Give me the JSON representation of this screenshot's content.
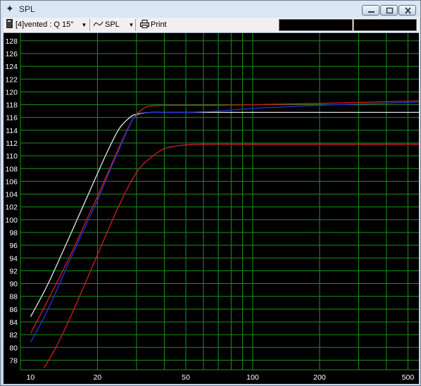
{
  "window": {
    "title": "SPL",
    "icon": "crosshair-icon"
  },
  "toolbar": {
    "project_selector": "[4]vented : Q 15''",
    "graph_selector": "SPL",
    "print_label": "Print"
  },
  "colors": {
    "grid": "#1f8f1f",
    "background": "#000000",
    "axis_text": "#ffffff"
  },
  "chart_data": {
    "type": "line",
    "x_scale": "log",
    "xlim": [
      9,
      560
    ],
    "ylim": [
      76.5,
      129.2
    ],
    "grid": true,
    "y_ticks": [
      78,
      80,
      82,
      84,
      86,
      88,
      90,
      92,
      94,
      96,
      98,
      100,
      102,
      104,
      106,
      108,
      110,
      112,
      114,
      116,
      118,
      120,
      122,
      124,
      126,
      128
    ],
    "x_tick_labels": [
      {
        "value": 10,
        "label": "10"
      },
      {
        "value": 20,
        "label": "20"
      },
      {
        "value": 50,
        "label": "50"
      },
      {
        "value": 100,
        "label": "100"
      },
      {
        "value": 200,
        "label": "200"
      },
      {
        "value": 500,
        "label": "500"
      }
    ],
    "x_gridlines": [
      20,
      30,
      40,
      50,
      60,
      70,
      80,
      90,
      100,
      200,
      300,
      400,
      500
    ],
    "series": [
      {
        "color": "#e6e6e6",
        "x": [
          10,
          12,
          15,
          18,
          20,
          22,
          25,
          28,
          30,
          35,
          40,
          50,
          70,
          100,
          200,
          560
        ],
        "y": [
          84.8,
          90.0,
          97.4,
          103.6,
          107.2,
          110.4,
          114.2,
          116.0,
          116.5,
          116.8,
          116.8,
          116.8,
          116.8,
          116.8,
          116.8,
          116.8
        ]
      },
      {
        "color": "#d21e1e",
        "x": [
          10,
          12,
          15,
          18,
          20,
          22,
          25,
          28,
          30,
          33,
          35,
          40,
          50,
          70,
          100,
          200,
          560
        ],
        "y": [
          82.2,
          87.5,
          94.2,
          100.2,
          103.6,
          106.9,
          111.3,
          114.9,
          116.5,
          117.6,
          117.8,
          117.9,
          117.9,
          117.9,
          118.0,
          118.2,
          118.6
        ]
      },
      {
        "color": "#2233e0",
        "x": [
          10,
          12,
          15,
          18,
          20,
          22,
          25,
          28,
          30,
          35,
          40,
          50,
          70,
          100,
          200,
          560
        ],
        "y": [
          80.8,
          86.0,
          93.6,
          99.6,
          103.0,
          106.5,
          111.0,
          114.8,
          116.3,
          116.8,
          116.8,
          116.8,
          117.0,
          117.4,
          117.9,
          118.4
        ]
      },
      {
        "color": "#d21e1e",
        "x": [
          11.5,
          13,
          15,
          18,
          20,
          25,
          30,
          35,
          40,
          45,
          50,
          60,
          100,
          560
        ],
        "y": [
          76.8,
          80.0,
          84.5,
          90.8,
          94.5,
          102.2,
          107.4,
          109.8,
          111.1,
          111.5,
          111.7,
          111.8,
          111.8,
          111.8
        ]
      }
    ]
  }
}
